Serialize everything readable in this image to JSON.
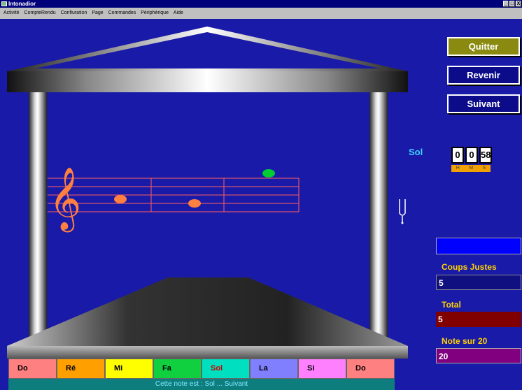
{
  "window": {
    "title": "Intonadior",
    "buttons": [
      "_",
      "□",
      "X"
    ]
  },
  "menu": [
    "Activité",
    "CompteRendu",
    "Confiuration",
    "Page",
    "Commandes",
    "Périphérique",
    "Aide"
  ],
  "side_buttons": {
    "quitter": "Quitter",
    "revenir": "Revenir",
    "suivant": "Suivant"
  },
  "current_note": "Sol",
  "timer": {
    "h": "0",
    "m": "0",
    "s": "58",
    "labels": [
      "H",
      "M",
      "S"
    ]
  },
  "stats": {
    "coups_label": "Coups Justes",
    "coups_value": "5",
    "total_label": "Total",
    "total_value": "5",
    "note_label": "Note sur  20",
    "note_value": "20"
  },
  "note_buttons": [
    {
      "label": "Do",
      "color": "#ff8080",
      "text": "#000000"
    },
    {
      "label": "Ré",
      "color": "#ffa000",
      "text": "#000000"
    },
    {
      "label": "Mi",
      "color": "#ffff00",
      "text": "#000000"
    },
    {
      "label": "Fa",
      "color": "#10d040",
      "text": "#000000"
    },
    {
      "label": "Sol",
      "color": "#00e0c0",
      "text": "#cc0000"
    },
    {
      "label": "La",
      "color": "#8080ff",
      "text": "#000000"
    },
    {
      "label": "Si",
      "color": "#ff80ff",
      "text": "#000000"
    },
    {
      "label": "Do",
      "color": "#ff8080",
      "text": "#000000"
    }
  ],
  "status_text": "Cette note est : Sol  ...  Suivant",
  "colors": {
    "background": "#1a1aa8",
    "note_played": "#ff8040",
    "note_target": "#00cc33",
    "staff": "#ff6060"
  }
}
